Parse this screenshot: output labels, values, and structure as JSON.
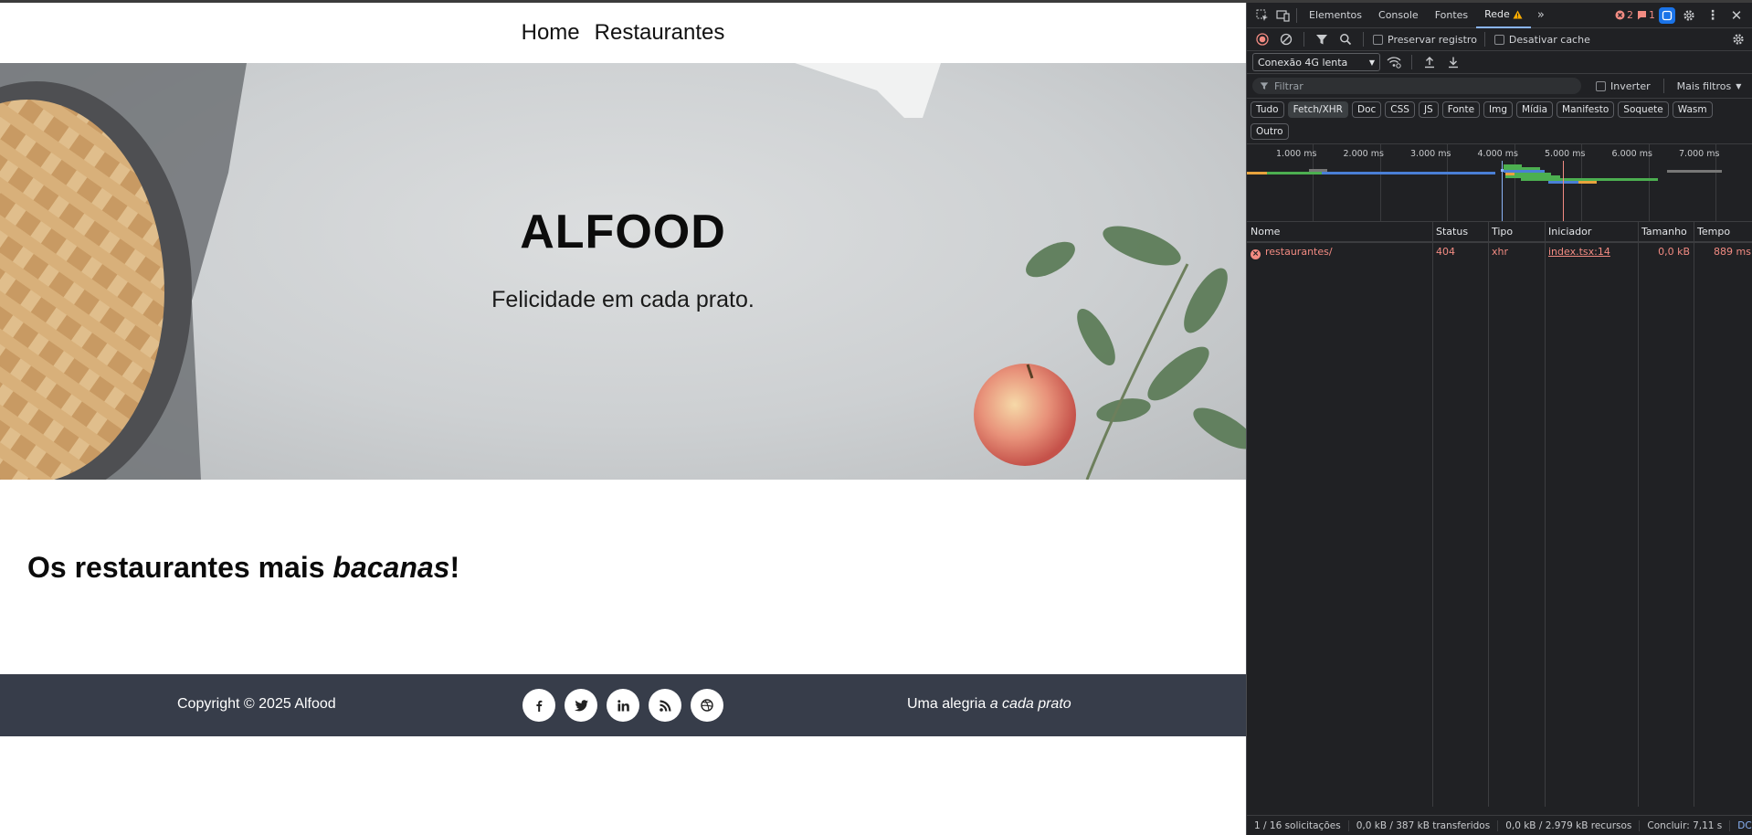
{
  "site": {
    "nav": {
      "home": "Home",
      "restaurants": "Restaurantes"
    },
    "hero": {
      "title": "ALFOOD",
      "subtitle": "Felicidade em cada prato."
    },
    "section": {
      "title_prefix": "Os restaurantes mais ",
      "title_emphasis": "bacanas",
      "title_suffix": "!"
    },
    "footer": {
      "copyright": "Copyright © 2025 Alfood",
      "social": [
        "facebook-icon",
        "twitter-icon",
        "linkedin-icon",
        "rss-icon",
        "dribbble-icon"
      ],
      "tagline_prefix": "Uma alegria ",
      "tagline_emphasis": "a cada prato"
    }
  },
  "devtools": {
    "tabs": [
      "Elementos",
      "Console",
      "Fontes",
      "Rede"
    ],
    "active_tab": "Rede",
    "error_count": "2",
    "warning_count": "1",
    "toolbar": {
      "preserve_log": "Preservar registro",
      "disable_cache": "Desativar cache"
    },
    "throttling": "Conexão 4G lenta",
    "filter": {
      "placeholder": "Filtrar",
      "invert": "Inverter",
      "more_filters": "Mais filtros"
    },
    "type_filters": [
      "Tudo",
      "Fetch/XHR",
      "Doc",
      "CSS",
      "JS",
      "Fonte",
      "Img",
      "Mídia",
      "Manifesto",
      "Soquete",
      "Wasm",
      "Outro"
    ],
    "active_type_filter": "Fetch/XHR",
    "timeline_ticks": [
      "1.000 ms",
      "2.000 ms",
      "3.000 ms",
      "4.000 ms",
      "5.000 ms",
      "6.000 ms",
      "7.000 ms"
    ],
    "columns": [
      "Nome",
      "Status",
      "Tipo",
      "Iniciador",
      "Tamanho",
      "Tempo"
    ],
    "requests": [
      {
        "name": "restaurantes/",
        "status": "404",
        "type": "xhr",
        "initiator": "index.tsx:14",
        "size": "0,0 kB",
        "time": "889 ms"
      }
    ],
    "statusbar": {
      "requests": "1 / 16 solicitações",
      "transferred": "0,0 kB / 387 kB transferidos",
      "resources": "0,0 kB / 2.979 kB recursos",
      "finish": "Concluir: 7,11 s",
      "dcl": "DC"
    },
    "colors": {
      "accent": "#8ab4f8",
      "error": "#f28b82",
      "background": "#202124"
    }
  }
}
